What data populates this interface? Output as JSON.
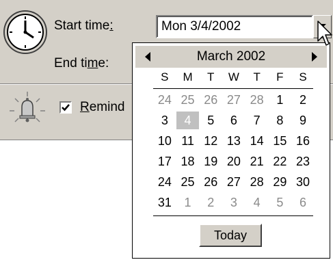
{
  "start_time": {
    "label_prefix": "Start time",
    "label_accel": ":",
    "value": "Mon 3/4/2002"
  },
  "end_time": {
    "label_prefix": "End ti",
    "label_accel": "m",
    "label_suffix": "e:"
  },
  "reminder": {
    "checked": true,
    "label_accel": "R",
    "label_rest": "emind"
  },
  "calendar": {
    "month_title": "March 2002",
    "weekdays": [
      "S",
      "M",
      "T",
      "W",
      "T",
      "F",
      "S"
    ],
    "weeks": [
      [
        "24",
        "25",
        "26",
        "27",
        "28",
        "1",
        "2"
      ],
      [
        "3",
        "4",
        "5",
        "6",
        "7",
        "8",
        "9"
      ],
      [
        "10",
        "11",
        "12",
        "13",
        "14",
        "15",
        "16"
      ],
      [
        "17",
        "18",
        "19",
        "20",
        "21",
        "22",
        "23"
      ],
      [
        "24",
        "25",
        "26",
        "27",
        "28",
        "29",
        "30"
      ],
      [
        "31",
        "1",
        "2",
        "3",
        "4",
        "5",
        "6"
      ]
    ],
    "dim_cells": [
      [
        0,
        0
      ],
      [
        0,
        1
      ],
      [
        0,
        2
      ],
      [
        0,
        3
      ],
      [
        0,
        4
      ],
      [
        5,
        1
      ],
      [
        5,
        2
      ],
      [
        5,
        3
      ],
      [
        5,
        4
      ],
      [
        5,
        5
      ],
      [
        5,
        6
      ]
    ],
    "selected_cell": [
      1,
      1
    ],
    "today_label": "Today"
  },
  "icons": {
    "clock": "clock-icon",
    "bell": "reminder-bell-icon",
    "dropdown": "chevron-down-icon",
    "prev": "chevron-left-icon",
    "next": "chevron-right-icon",
    "cursor": "mouse-pointer-icon"
  },
  "colors": {
    "dialog_bg": "#d4d0c8",
    "selected_day_bg": "#c0c0c0",
    "dim_day_text": "#8a8a8a"
  }
}
